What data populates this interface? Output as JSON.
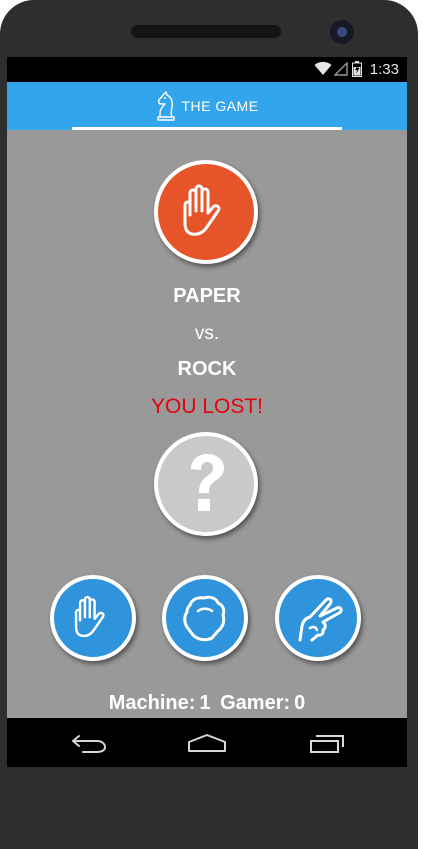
{
  "status_bar": {
    "time": "1:33"
  },
  "header": {
    "tab_label": "THE GAME",
    "icon": "knight-icon"
  },
  "game": {
    "machine_choice": "PAPER",
    "vs": "vs.",
    "gamer_choice": "ROCK",
    "result": "YOU LOST!",
    "machine_icon": "hand-paper-icon",
    "gamer_icon": "question-mark-icon"
  },
  "choices": [
    {
      "name": "paper",
      "icon": "hand-paper-icon"
    },
    {
      "name": "rock",
      "icon": "fist-rock-icon"
    },
    {
      "name": "scissors",
      "icon": "hand-scissors-icon"
    }
  ],
  "score": {
    "machine_label": "Machine:",
    "machine_value": "1",
    "gamer_label": "Gamer:",
    "gamer_value": "0"
  },
  "nav": {
    "buttons": [
      "back-icon",
      "home-icon",
      "recent-apps-icon"
    ]
  },
  "colors": {
    "accent": "#33a5ec",
    "machine": "#e6552a",
    "choice": "#2f94db",
    "unknown": "#c9c9c9",
    "lost": "#e8000c",
    "background": "#999999"
  }
}
